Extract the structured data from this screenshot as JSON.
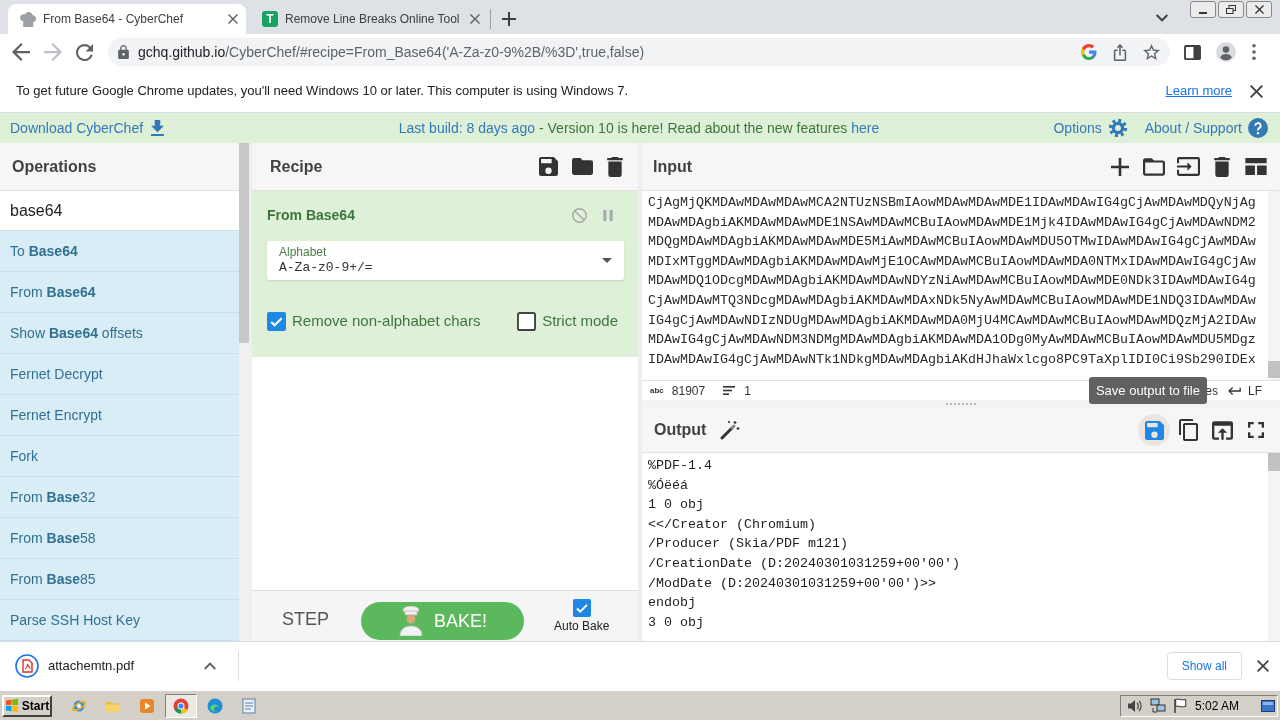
{
  "browser": {
    "tabs": [
      {
        "title": "From Base64 - CyberChef",
        "selected": true,
        "favicon": {
          "kind": "hat"
        }
      },
      {
        "title": "Remove Line Breaks Online Tool",
        "selected": false,
        "favicon": {
          "kind": "letter",
          "text": "T"
        }
      }
    ],
    "address": {
      "host": "gchq.github.io",
      "path": "/CyberChef/#recipe=From_Base64('A-Za-z0-9%2B/%3D',true,false)"
    },
    "infobar": {
      "message": "To get future Google Chrome updates, you'll need Windows 10 or later. This computer is using Windows 7.",
      "link": "Learn more"
    }
  },
  "banner": {
    "download": "Download CyberChef",
    "build": "Last build: 8 days ago",
    "message": "- Version 10 is here! Read about the new features",
    "features_link": "here",
    "options": "Options",
    "about": "About / Support"
  },
  "operations": {
    "title": "Operations",
    "search": "base64",
    "items": [
      "To **Base64**",
      "From **Base64**",
      "Show **Base64** offsets",
      "Fernet Decrypt",
      "Fernet Encrypt",
      "Fork",
      "From **Base**32",
      "From **Base**58",
      "From **Base**85",
      "Parse SSH Host Key"
    ]
  },
  "recipe": {
    "title": "Recipe",
    "operation": {
      "name": "From Base64",
      "field": {
        "label": "Alphabet",
        "value": "A-Za-z0-9+/="
      },
      "options": [
        {
          "label": "Remove non-alphabet chars",
          "checked": true
        },
        {
          "label": "Strict mode",
          "checked": false
        }
      ]
    },
    "step": "STEP",
    "bake": "BAKE!",
    "auto_bake": {
      "label": "Auto Bake",
      "checked": true
    }
  },
  "input": {
    "title": "Input",
    "lines": [
      "CjAgMjQKMDAwMDAwMDAwMCA2NTUzNSBmIAowMDAwMDAwMDE1IDAwMDAwIG4gCjAwMDAwMDQyNjAg",
      "MDAwMDAgbiAKMDAwMDAwMDE1NSAwMDAwMCBuIAowMDAwMDE1Mjk4IDAwMDAwIG4gCjAwMDAwNDM2",
      "MDQgMDAwMDAgbiAKMDAwMDAwMDE5MiAwMDAwMCBuIAowMDAwMDU5OTMwIDAwMDAwIG4gCjAwMDAw",
      "MDIxMTggMDAwMDAgbiAKMDAwMDAwMjE1OCAwMDAwMCBuIAowMDAwMDA0NTMxIDAwMDAwIG4gCjAw",
      "MDAwMDQ1ODcgMDAwMDAgbiAKMDAwMDAwNDYzNiAwMDAwMCBuIAowMDAwMDE0NDk3IDAwMDAwIG4g",
      "CjAwMDAwMTQ3NDcgMDAwMDAgbiAKMDAwMDAxNDk5NyAwMDAwMCBuIAowMDAwMDE1NDQ3IDAwMDAw",
      "IG4gCjAwMDAwNDIzNDUgMDAwMDAgbiAKMDAwMDA0MjU4MCAwMDAwMCBuIAowMDAwMDQzMjA2IDAw",
      "MDAwIG4gCjAwMDAwNDM3NDMgMDAwMDAgbiAKMDAwMDA1ODg0MyAwMDAwMCBuIAowMDAwMDU5MDgz",
      "IDAwMDAwIG4gCjAwMDAwNTk1NDkgMDAwMDAgbiAKdHJhaWxlcgo8PC9TaXplIDI0Ci9Sb290IDEx"
    ],
    "status": {
      "chars_icon": "abc",
      "chars": "81907",
      "lines": "1",
      "format_partial": "es",
      "eol": "LF"
    }
  },
  "tooltip": "Save output to file",
  "output": {
    "title": "Output",
    "tools": [
      {
        "kind": "save",
        "highlighted": true
      },
      {
        "kind": "copy",
        "highlighted": false
      },
      {
        "kind": "replace",
        "highlighted": false
      },
      {
        "kind": "fullscreen",
        "highlighted": false
      }
    ],
    "lines": [
      "%PDF-1.4",
      "%Óëéá",
      "1 0 obj",
      "<</Creator (Chromium)",
      "/Producer (Skia/PDF m121)",
      "/CreationDate (D:20240301031259+00'00')",
      "/ModDate (D:20240301031259+00'00')>>",
      "endobj",
      "3 0 obj"
    ]
  },
  "download_bar": {
    "file": "attachemtn.pdf",
    "show_all": "Show all"
  },
  "taskbar": {
    "start": "Start",
    "apps": [
      {
        "kind": "globe",
        "selected": false
      },
      {
        "kind": "folder",
        "selected": false
      },
      {
        "kind": "media",
        "selected": false
      },
      {
        "kind": "browser",
        "selected": true
      },
      {
        "kind": "wave",
        "selected": false
      },
      {
        "kind": "notepad",
        "selected": false
      }
    ],
    "clock": "5:02 AM"
  }
}
